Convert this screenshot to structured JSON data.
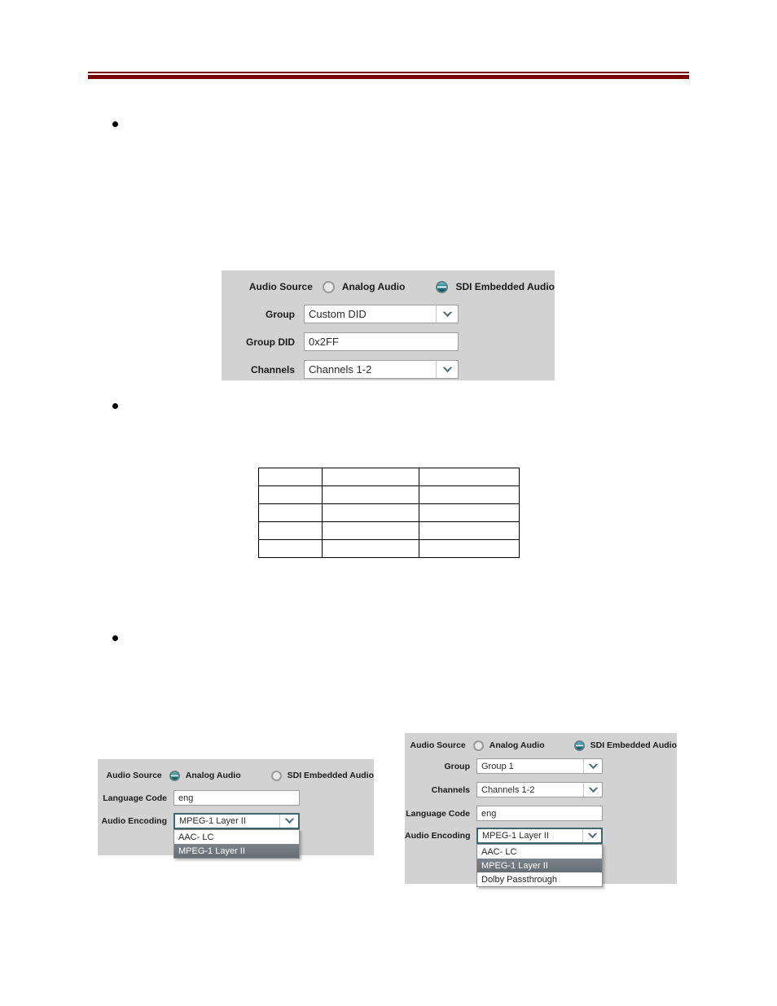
{
  "page": {
    "background_color": "#ffffff",
    "header_rule_color": "#7b0000",
    "panel_background_color": "#d2d2d2",
    "selected_radio_color": "#1c7d85",
    "dropdown_highlight_color": "#71797f",
    "focused_border_color": "#3c6670"
  },
  "bullets": [
    {
      "name": "bullet-1"
    },
    {
      "name": "bullet-2"
    },
    {
      "name": "bullet-3"
    }
  ],
  "panel_sdi": {
    "audio_source_label": "Audio Source",
    "radio_analog_label": "Analog Audio",
    "radio_sdi_label": "SDI Embedded Audio",
    "selected_source": "SDI Embedded Audio",
    "group_label": "Group",
    "group_value": "Custom DID",
    "group_did_label": "Group DID",
    "group_did_value": "0x2FF",
    "channels_label": "Channels",
    "channels_value": "Channels 1-2"
  },
  "blank_table": {
    "rows": 5,
    "columns": 3,
    "cells": [
      [
        "",
        "",
        ""
      ],
      [
        "",
        "",
        ""
      ],
      [
        "",
        "",
        ""
      ],
      [
        "",
        "",
        ""
      ],
      [
        "",
        "",
        ""
      ]
    ]
  },
  "panel_analog": {
    "audio_source_label": "Audio Source",
    "radio_analog_label": "Analog Audio",
    "radio_sdi_label": "SDI Embedded Audio",
    "selected_source": "Analog Audio",
    "language_code_label": "Language Code",
    "language_code_value": "eng",
    "audio_encoding_label": "Audio Encoding",
    "audio_encoding_value": "MPEG-1 Layer II",
    "audio_encoding_options": [
      "AAC- LC",
      "MPEG-1 Layer II"
    ],
    "audio_encoding_selected_index": 1
  },
  "panel_embedded": {
    "audio_source_label": "Audio Source",
    "radio_analog_label": "Analog Audio",
    "radio_sdi_label": "SDI Embedded Audio",
    "selected_source": "SDI Embedded Audio",
    "group_label": "Group",
    "group_value": "Group 1",
    "channels_label": "Channels",
    "channels_value": "Channels 1-2",
    "language_code_label": "Language Code",
    "language_code_value": "eng",
    "audio_encoding_label": "Audio Encoding",
    "audio_encoding_value": "MPEG-1 Layer II",
    "audio_encoding_options": [
      "AAC- LC",
      "MPEG-1 Layer II",
      "Dolby Passthrough"
    ],
    "audio_encoding_selected_index": 1
  }
}
